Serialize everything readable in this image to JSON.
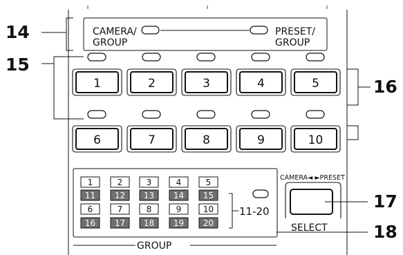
{
  "mode_switch": {
    "camera_label_line1": "CAMERA/",
    "camera_label_line2": "GROUP",
    "preset_label_line1": "PRESET/",
    "preset_label_line2": "GROUP"
  },
  "top_buttons": [
    "1",
    "2",
    "3",
    "4",
    "5"
  ],
  "bottom_buttons": [
    "6",
    "7",
    "8",
    "9",
    "10"
  ],
  "group_panel": {
    "rows": [
      [
        {
          "label": "1",
          "dark": false
        },
        {
          "label": "2",
          "dark": false
        },
        {
          "label": "3",
          "dark": false
        },
        {
          "label": "4",
          "dark": false
        },
        {
          "label": "5",
          "dark": false
        }
      ],
      [
        {
          "label": "11",
          "dark": true
        },
        {
          "label": "12",
          "dark": true
        },
        {
          "label": "13",
          "dark": true
        },
        {
          "label": "14",
          "dark": true
        },
        {
          "label": "15",
          "dark": true
        }
      ],
      [
        {
          "label": "6",
          "dark": false
        },
        {
          "label": "7",
          "dark": false
        },
        {
          "label": "8",
          "dark": false
        },
        {
          "label": "9",
          "dark": false
        },
        {
          "label": "10",
          "dark": false
        }
      ],
      [
        {
          "label": "16",
          "dark": true
        },
        {
          "label": "17",
          "dark": true
        },
        {
          "label": "18",
          "dark": true
        },
        {
          "label": "19",
          "dark": true
        },
        {
          "label": "20",
          "dark": true
        }
      ]
    ],
    "range_label": "11-20",
    "group_label": "GROUP"
  },
  "select_control": {
    "top_label": "CAMERA◄ ►PRESET",
    "bottom_label": "SELECT"
  },
  "callouts": {
    "c14": "14",
    "c15": "15",
    "c16": "16",
    "c17": "17",
    "c18": "18"
  },
  "colors": {
    "line": "#111111",
    "dark_cell": "#707070",
    "dark_cell_text": "#ffffff"
  }
}
